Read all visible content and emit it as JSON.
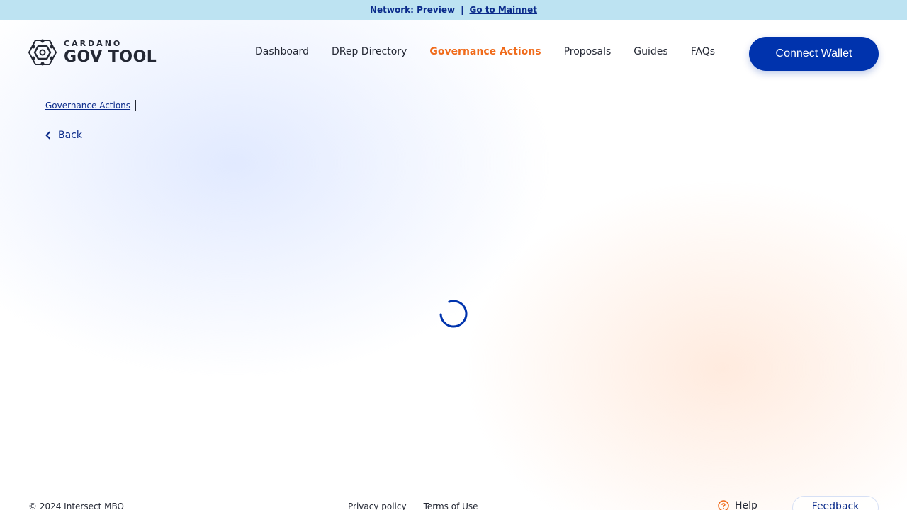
{
  "network_bar": {
    "network_label": "Network: Preview",
    "separator": "|",
    "mainnet_link": "Go to Mainnet"
  },
  "logo": {
    "top": "CARDANO",
    "bottom": "GOV TOOL"
  },
  "nav": {
    "items": [
      {
        "label": "Dashboard",
        "active": false
      },
      {
        "label": "DRep Directory",
        "active": false
      },
      {
        "label": "Governance Actions",
        "active": true
      },
      {
        "label": "Proposals",
        "active": false
      },
      {
        "label": "Guides",
        "active": false
      },
      {
        "label": "FAQs",
        "active": false
      }
    ],
    "connect_wallet": "Connect Wallet"
  },
  "breadcrumb": {
    "link": "Governance Actions"
  },
  "back": {
    "label": "Back"
  },
  "footer": {
    "copyright": "© 2024 Intersect MBO",
    "links": [
      "Privacy policy",
      "Terms of Use"
    ],
    "help": "Help",
    "feedback": "Feedback"
  },
  "colors": {
    "primary": "#0033ad",
    "accent": "#f06b1b",
    "banner": "#bde3f2",
    "text": "#242834"
  },
  "icons": {
    "logo": "hexagon-logo-icon",
    "back": "chevron-left-icon",
    "help": "question-circle-icon",
    "loading": "spinner-icon"
  }
}
